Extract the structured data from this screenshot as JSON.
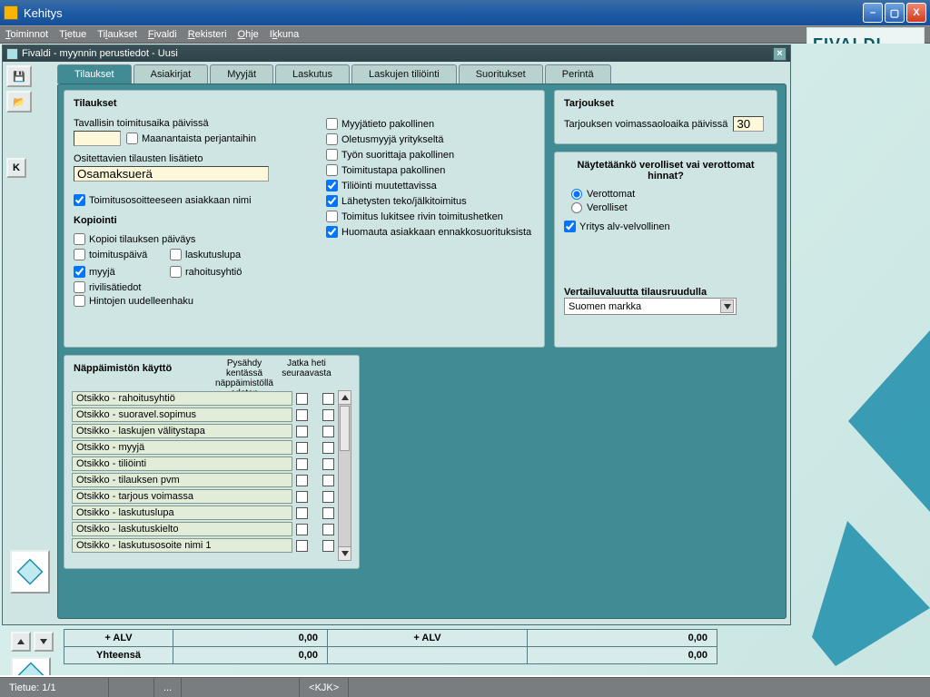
{
  "window": {
    "title": "Kehitys"
  },
  "menubar": [
    "Toiminnot",
    "Tietue",
    "Tilaukset",
    "Fivaldi",
    "Rekisteri",
    "Ohje",
    "Ikkuna"
  ],
  "brand": "FIVALDI",
  "subwin": {
    "title": "Fivaldi - myynnin perustiedot - Uusi"
  },
  "kbtn": "K",
  "tabs": [
    "Tilaukset",
    "Asiakirjat",
    "Myyjät",
    "Laskutus",
    "Laskujen tiliöinti",
    "Suoritukset",
    "Perintä"
  ],
  "active_tab": 0,
  "tilaukset": {
    "heading": "Tilaukset",
    "deliv_label": "Tavallisin toimitusaika päivissä",
    "deliv_value": "",
    "chk_monfr": "Maanantaista perjantaihin",
    "addrinfo_label": "Ositettavien tilausten lisätieto",
    "addrinfo_value": "Osamaksuerä",
    "chk_toimnimi": "Toimitusosoitteeseen asiakkaan nimi",
    "kop_heading": "Kopiointi",
    "kop": {
      "kopioi": "Kopioi tilauksen päiväys",
      "toimituspaiva": "toimituspäivä",
      "laskutuslupa": "laskutuslupa",
      "myyja": "myyjä",
      "rahoitusyhtio": "rahoitusyhtiö",
      "rivilisatiedot": "rivilisätiedot",
      "hintojen": "Hintojen uudelleenhaku"
    },
    "right_checks": [
      {
        "label": "Myyjätieto pakollinen",
        "checked": false
      },
      {
        "label": "Oletusmyyjä yritykseltä",
        "checked": false
      },
      {
        "label": "Työn suorittaja pakollinen",
        "checked": false
      },
      {
        "label": "Toimitustapa pakollinen",
        "checked": false
      },
      {
        "label": "Tiliöinti muutettavissa",
        "checked": true
      },
      {
        "label": "Lähetysten teko/jälkitoimitus",
        "checked": true
      },
      {
        "label": "Toimitus lukitsee rivin toimitushetken",
        "checked": false
      },
      {
        "label": "Huomauta asiakkaan ennakkosuorituksista",
        "checked": true
      }
    ]
  },
  "tarjoukset": {
    "heading": "Tarjoukset",
    "label": "Tarjouksen voimassaoloaika päivissä",
    "value": "30"
  },
  "naytetaanko": {
    "heading": "Näytetäänkö verolliset vai verottomat hinnat?",
    "verottomat": "Verottomat",
    "verolliset": "Verolliset",
    "selected": "verottomat",
    "yritys_label": "Yritys alv-velvollinen",
    "yritys_checked": true,
    "vertailu_label": "Vertailuvaluutta tilausruudulla",
    "vertailu_value": "Suomen markka"
  },
  "keyboard": {
    "heading": "Näppäimistön käyttö",
    "col1": "Pysähdy kentässä näppäimistöllä edeten",
    "col2": "Jatka heti seuraavasta",
    "rows": [
      "Otsikko - rahoitusyhtiö",
      "Otsikko - suoravel.sopimus",
      "Otsikko - laskujen välitystapa",
      "Otsikko - myyjä",
      "Otsikko - tiliöinti",
      "Otsikko - tilauksen pvm",
      "Otsikko - tarjous voimassa",
      "Otsikko - laskutuslupa",
      "Otsikko - laskutuskielto",
      "Otsikko - laskutusosoite nimi 1"
    ]
  },
  "footer": {
    "alv": "+ ALV",
    "yht": "Yhteensä",
    "zero": "0,00"
  },
  "status": {
    "record": "Tietue: 1/1",
    "dots": "...",
    "user": "<KJK>"
  }
}
